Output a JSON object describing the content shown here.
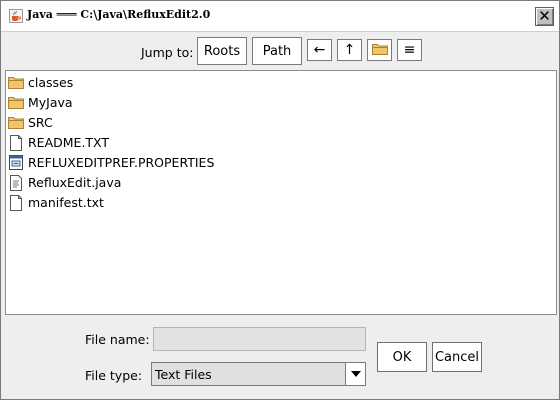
{
  "window": {
    "title": "Java ═══ C:\\Java\\RefluxEdit2.0",
    "close_symbol": "✕"
  },
  "nav": {
    "jump_label": "Jump to:",
    "roots_label": "Roots",
    "path_label": "Path",
    "back_symbol": "←",
    "up_symbol": "↑",
    "folder_icon": "folder-icon",
    "menu_symbol": "≡"
  },
  "files": [
    {
      "name": "classes",
      "icon": "folder-icon"
    },
    {
      "name": "MyJava",
      "icon": "folder-icon"
    },
    {
      "name": "SRC",
      "icon": "folder-icon"
    },
    {
      "name": "README.TXT",
      "icon": "document-icon"
    },
    {
      "name": "REFLUXEDITPREF.PROPERTIES",
      "icon": "properties-file-icon"
    },
    {
      "name": "RefluxEdit.java",
      "icon": "java-file-icon"
    },
    {
      "name": "manifest.txt",
      "icon": "document-icon"
    }
  ],
  "form": {
    "file_name_label": "File name:",
    "file_name_value": "",
    "file_type_label": "File type:",
    "file_type_value": "Text Files"
  },
  "actions": {
    "ok_label": "OK",
    "cancel_label": "Cancel"
  },
  "colors": {
    "folder": "#f2c46d",
    "folder_outline": "#a98430",
    "selection_border": "#7a7a7a"
  }
}
